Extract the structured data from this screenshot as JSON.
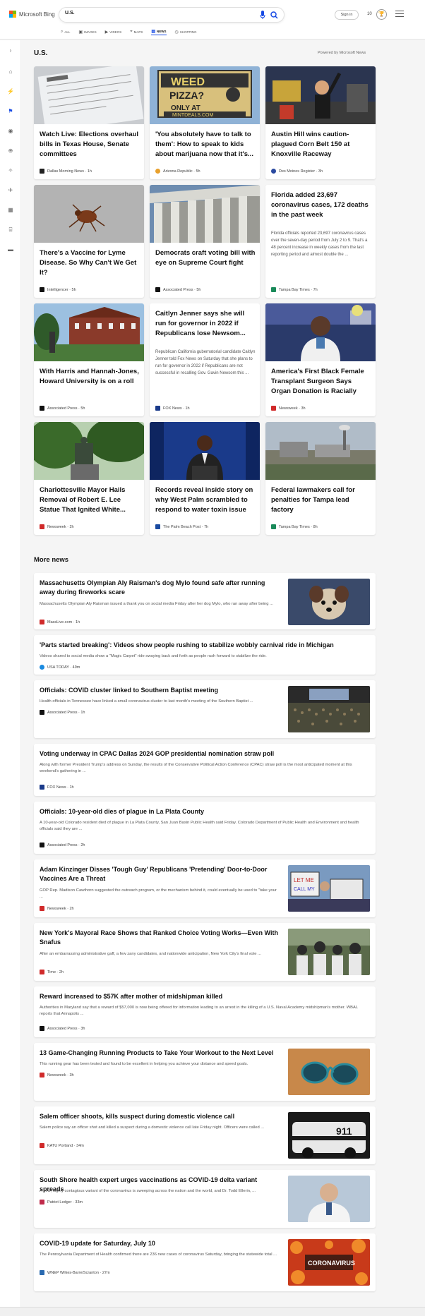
{
  "header": {
    "brand": "Microsoft Bing",
    "search_value": "U.S.",
    "signin_label": "Sign in",
    "rewards_count": "10",
    "tabs": [
      {
        "label": "ALL",
        "icon": "search-icon"
      },
      {
        "label": "IMAGES",
        "icon": "image-icon"
      },
      {
        "label": "VIDEOS",
        "icon": "video-icon"
      },
      {
        "label": "MAPS",
        "icon": "map-pin-icon"
      },
      {
        "label": "NEWS",
        "icon": "news-icon"
      },
      {
        "label": "SHOPPING",
        "icon": "shopping-bag-icon"
      }
    ]
  },
  "page": {
    "title": "U.S.",
    "powered_by": "Powered by Microsoft News"
  },
  "top_stories": [
    {
      "title": "Watch Live: Elections overhaul bills in Texas House, Senate committees",
      "source": "Dallas Morning News · 1h",
      "image": "ballot-form-photo"
    },
    {
      "title": "'You absolutely have to talk to them': How to speak to kids about marijuana now that it's...",
      "source": "Arizona Republic · 5h",
      "image": "weed-pizza-billboard-photo"
    },
    {
      "title": "Austin Hill wins caution-plagued Corn Belt 150 at Knoxville Raceway",
      "source": "Des Moines Register · 3h",
      "image": "race-winner-celebration-photo"
    },
    {
      "title": "There's a Vaccine for Lyme Disease. So Why Can't We Get It?",
      "source": "Intelligencer · 5h",
      "image": "tick-photo"
    },
    {
      "title": "Democrats craft voting bill with eye on Supreme Court fight",
      "source": "Associated Press · 5h",
      "image": "supreme-court-columns-photo"
    },
    {
      "title": "Florida added 23,697 coronavirus cases, 172 deaths in the past week",
      "snippet": "Florida officials reported 23,697 coronavirus cases over the seven-day period from July 2 to 9. That's a 48 percent increase in weekly cases from the last reporting period and almost double the ...",
      "source": "Tampa Bay Times · 7h"
    },
    {
      "title": "With Harris and Hannah-Jones, Howard University is on a roll",
      "source": "Associated Press · 5h",
      "image": "howard-university-campus-photo"
    },
    {
      "title": "Caitlyn Jenner says she will run for governor in 2022 if Republicans lose Newsom...",
      "snippet": "Republican California gubernatorial candidate Caitlyn Jenner told Fox News on Saturday that she plans to run for governor in 2022 if Republicans are not successful in recalling Gov. Gavin Newsom this ...",
      "source": "FOX News · 1h"
    },
    {
      "title": "America's First Black Female Transplant Surgeon Says Organ Donation is Racially Lopsided",
      "source": "Newsweek · 3h",
      "image": "surgeon-portrait-photo"
    },
    {
      "title": "Charlottesville Mayor Hails Removal of Robert E. Lee Statue That Ignited White...",
      "source": "Newsweek · 2h",
      "image": "statue-in-trees-photo"
    },
    {
      "title": "Records reveal inside story on why West Palm scrambled to respond to water toxin issue",
      "source": "The Palm Beach Post · 7h",
      "image": "official-at-podium-photo"
    },
    {
      "title": "Federal lawmakers call for penalties for Tampa lead factory",
      "source": "Tampa Bay Times · 8h",
      "image": "industrial-factory-photo"
    }
  ],
  "more_news_title": "More news",
  "more_news": [
    {
      "title": "Massachusetts Olympian Aly Raisman's dog Mylo found safe after running away during fireworks scare",
      "snippet": "Massachusetts Olympian Aly Raisman issued a thank you on social media Friday after her dog Mylo, who ran away after being ...",
      "source": "MassLive.com · 1h",
      "image": "small-dog-photo"
    },
    {
      "title": "'Parts started breaking': Videos show people rushing to stabilize wobbly carnival ride in Michigan",
      "snippet": "Videos shared to social media show a \"Magic Carpet\" ride swaying back and forth as people rush forward to stabilize the ride.",
      "source": "USA TODAY · 49m"
    },
    {
      "title": "Officials: COVID cluster linked to Southern Baptist meeting",
      "snippet": "Health officials in Tennessee have linked a small coronavirus cluster to last month's meeting of the Southern Baptist ...",
      "source": "Associated Press · 1h",
      "image": "convention-hall-crowd-photo"
    },
    {
      "title": "Voting underway in CPAC Dallas 2024 GOP presidential nomination straw poll",
      "snippet": "Along with former President Trump's address on Sunday, the results of the Conservative Political Action Conference (CPAC) straw poll is the most anticipated moment at this weekend's gathering in ...",
      "source": "FOX News · 1h"
    },
    {
      "title": "Officials: 10-year-old dies of plague in La Plata County",
      "snippet": "A 10-year-old Colorado resident died of plague in La Plata County, San Juan Basin Public Health said Friday. Colorado Department of Public Health and Environment and health officials said they are ...",
      "source": "Associated Press · 2h"
    },
    {
      "title": "Adam Kinzinger Disses 'Tough Guy' Republicans 'Pretending' Door-to-Door Vaccines Are a Threat",
      "snippet": "GOP Rep. Madison Cawthorn suggested the outreach program, or the mechanism behind it, could eventually be used to \"take your ...",
      "source": "Newsweek · 2h",
      "image": "protest-signs-photo"
    },
    {
      "title": "New York's Mayoral Race Shows that Ranked Choice Voting Works—Even With Snafus",
      "snippet": "After an embarrassing administrative gaff, a few zany candidates, and nationwide anticipation, New York City's final vote ...",
      "source": "Time · 2h",
      "image": "crowd-rally-photo"
    },
    {
      "title": "Reward increased to $57K after mother of midshipman killed",
      "snippet": "Authorities in Maryland say that a reward of $57,000 is now being offered for information leading to an arrest in the killing of a U.S. Naval Academy midshipman's mother. WBAL reports that Annapolis ...",
      "source": "Associated Press · 3h"
    },
    {
      "title": "13 Game-Changing Running Products to Take Your Workout to the Next Level",
      "snippet": "This running gear has been tested and found to be excellent in helping you achieve your distance and speed goals.",
      "source": "Newsweek · 3h",
      "image": "earbuds-photo"
    },
    {
      "title": "Salem officer shoots, kills suspect during domestic violence call",
      "snippet": "Salem police say an officer shot and killed a suspect during a domestic violence call late Friday night. Officers were called ...",
      "source": "KATU Portland · 34m",
      "image": "police-car-photo"
    },
    {
      "title": "South Shore health expert urges vaccinations as COVID-19 delta variant spreads",
      "snippet": "A new, highly contagious variant of the coronavirus is sweeping across the nation and the world, and Dr. Todd Ellerin, ...",
      "source": "Patriot Ledger · 33m",
      "image": "doctor-portrait-photo"
    },
    {
      "title": "COVID-19 update for Saturday, July 10",
      "snippet": "The Pennsylvania Department of Health confirmed there are 236 new cases of coronavirus Saturday, bringing the statewide total ...",
      "source": "WNEP Wilkes-Barre/Scranton · 27m",
      "image": "coronavirus-flowers-graphic",
      "image_text": "CORONAVIRUS"
    }
  ],
  "colors": {
    "accent": "#174ae4",
    "background": "#f5f5f5"
  }
}
